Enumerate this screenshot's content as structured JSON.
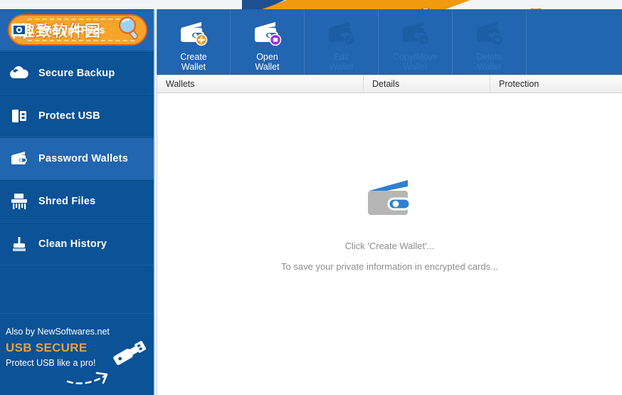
{
  "window": {
    "top_strip": {
      "blue_icon_name": "partial-blue-icon",
      "brown_icon_name": "partial-brown-icon"
    }
  },
  "sidebar": {
    "logo": {
      "text": "趣致软件园",
      "icon": "magnifier-icon",
      "badge_color": "#f7a42b",
      "border_color": "#e2661a"
    },
    "items": [
      {
        "label": "Encrypt Files",
        "icon": "safe-box-icon",
        "active": false
      },
      {
        "label": "Secure Backup",
        "icon": "cloud-icon",
        "active": false
      },
      {
        "label": "Protect USB",
        "icon": "usb-drive-icon",
        "active": false
      },
      {
        "label": "Password Wallets",
        "icon": "wallet-icon",
        "active": true
      },
      {
        "label": "Shred Files",
        "icon": "shredder-icon",
        "active": false
      },
      {
        "label": "Clean History",
        "icon": "broom-icon",
        "active": false
      }
    ],
    "promo": {
      "also_by": "Also by NewSoftwares.net",
      "brand": "USB SECURE",
      "tagline": "Protect USB like a pro!",
      "brand_color": "#e8a33d",
      "icon": "usb-drive-icon",
      "arrow_icon": "dashed-arrow-icon"
    },
    "background_color": "#0b5296",
    "active_color": "#2265b0"
  },
  "toolbar": {
    "background_color": "#2265b0",
    "buttons": [
      {
        "label": "Create\nWallet",
        "icon": "wallet-add-icon",
        "badge_color": "#e59a21",
        "enabled": true
      },
      {
        "label": "Open\nWallet",
        "icon": "wallet-open-icon",
        "badge_color": "#9b30d9",
        "enabled": true
      },
      {
        "label": "Edit\nWallet",
        "icon": "wallet-edit-icon",
        "badge_color": "",
        "enabled": false
      },
      {
        "label": "Copy/Move\nWallet",
        "icon": "wallet-copy-move-icon",
        "badge_color": "",
        "enabled": false
      },
      {
        "label": "Delete\nWallet",
        "icon": "wallet-delete-icon",
        "badge_color": "",
        "enabled": false
      }
    ]
  },
  "table": {
    "columns": [
      {
        "label": "Wallets"
      },
      {
        "label": "Details"
      },
      {
        "label": "Protection"
      }
    ],
    "rows": []
  },
  "empty_state": {
    "icon": "wallet-icon",
    "line1": "Click 'Create Wallet'...",
    "line2": "To save your private information in encrypted cards...",
    "text_color": "#8e8e8e"
  }
}
